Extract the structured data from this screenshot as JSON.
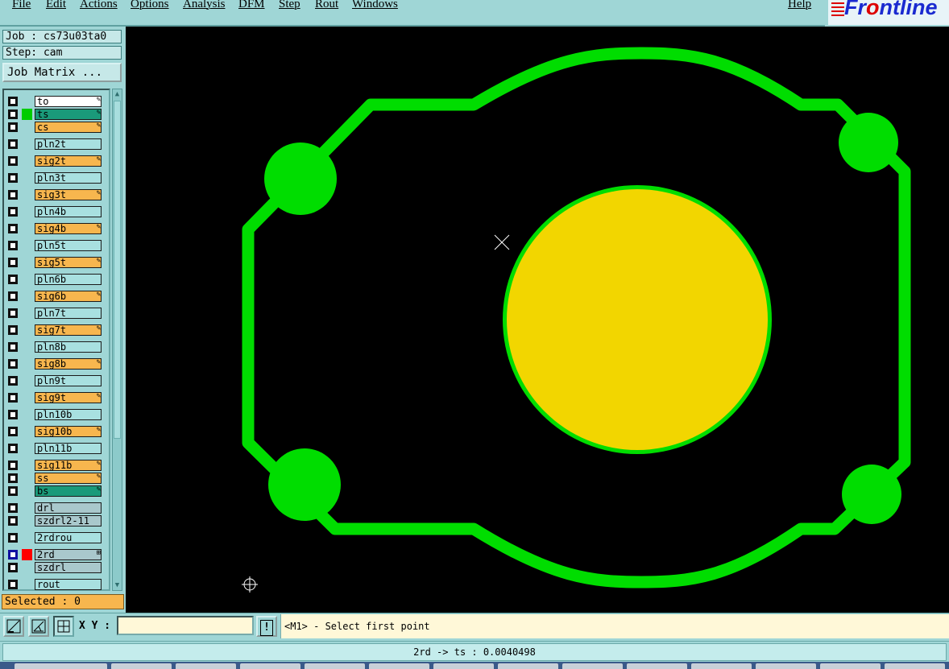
{
  "menu": {
    "items": [
      "File",
      "Edit",
      "Actions",
      "Options",
      "Analysis",
      "DFM",
      "Step",
      "Rout",
      "Windows"
    ],
    "help": "Help",
    "logo": "Frontline"
  },
  "panel": {
    "job": "Job : cs73u03ta0",
    "step": "Step: cam",
    "job_matrix": "Job Matrix ...",
    "selected": "Selected : 0"
  },
  "layers": [
    {
      "name": "to",
      "type": "white",
      "color": "",
      "mark": "✎"
    },
    {
      "name": "ts",
      "type": "green",
      "color": "#00cc00",
      "mark": "✎"
    },
    {
      "name": "cs",
      "type": "board",
      "color": "",
      "mark": "✎"
    },
    {
      "name": "pln2t",
      "type": "plane",
      "color": "",
      "mark": ""
    },
    {
      "name": "sig2t",
      "type": "board",
      "color": "",
      "mark": "✎"
    },
    {
      "name": "pln3t",
      "type": "plane",
      "color": "",
      "mark": ""
    },
    {
      "name": "sig3t",
      "type": "board",
      "color": "",
      "mark": "✎"
    },
    {
      "name": "pln4b",
      "type": "plane",
      "color": "",
      "mark": ""
    },
    {
      "name": "sig4b",
      "type": "board",
      "color": "",
      "mark": "✎"
    },
    {
      "name": "pln5t",
      "type": "plane",
      "color": "",
      "mark": ""
    },
    {
      "name": "sig5t",
      "type": "board",
      "color": "",
      "mark": "✎"
    },
    {
      "name": "pln6b",
      "type": "plane",
      "color": "",
      "mark": ""
    },
    {
      "name": "sig6b",
      "type": "board",
      "color": "",
      "mark": "✎"
    },
    {
      "name": "pln7t",
      "type": "plane",
      "color": "",
      "mark": ""
    },
    {
      "name": "sig7t",
      "type": "board",
      "color": "",
      "mark": "✎"
    },
    {
      "name": "pln8b",
      "type": "plane",
      "color": "",
      "mark": ""
    },
    {
      "name": "sig8b",
      "type": "board",
      "color": "",
      "mark": "✎"
    },
    {
      "name": "pln9t",
      "type": "plane",
      "color": "",
      "mark": ""
    },
    {
      "name": "sig9t",
      "type": "board",
      "color": "",
      "mark": "✎"
    },
    {
      "name": "pln10b",
      "type": "plane",
      "color": "",
      "mark": ""
    },
    {
      "name": "sig10b",
      "type": "board",
      "color": "",
      "mark": "✎"
    },
    {
      "name": "pln11b",
      "type": "plane",
      "color": "",
      "mark": ""
    },
    {
      "name": "sig11b",
      "type": "board",
      "color": "",
      "mark": "✎"
    },
    {
      "name": "ss",
      "type": "board",
      "color": "",
      "mark": "✎"
    },
    {
      "name": "bs",
      "type": "green",
      "color": "",
      "mark": "✎"
    },
    {
      "name": "drl",
      "type": "drill",
      "color": "",
      "mark": ""
    },
    {
      "name": "szdrl2-11",
      "type": "drill",
      "color": "",
      "mark": ""
    },
    {
      "name": "2rdrou",
      "type": "plane",
      "color": "",
      "mark": ""
    },
    {
      "name": "2rd",
      "type": "drill",
      "color": "#ff0000",
      "mark": "⊞",
      "active": true
    },
    {
      "name": "szdrl",
      "type": "drill",
      "color": "",
      "mark": ""
    },
    {
      "name": "rout",
      "type": "plane",
      "color": "",
      "mark": ""
    }
  ],
  "toolbar": {
    "xy_label": "X Y :",
    "xy_value": "",
    "bang": "!",
    "prompt": "<M1> - Select first point"
  },
  "status": {
    "text": "2rd -> ts : 0.0040498"
  },
  "colors": {
    "copper": "#00dd00",
    "drill": "#f2d600",
    "background": "#000000",
    "panel": "#9fd6d6"
  }
}
